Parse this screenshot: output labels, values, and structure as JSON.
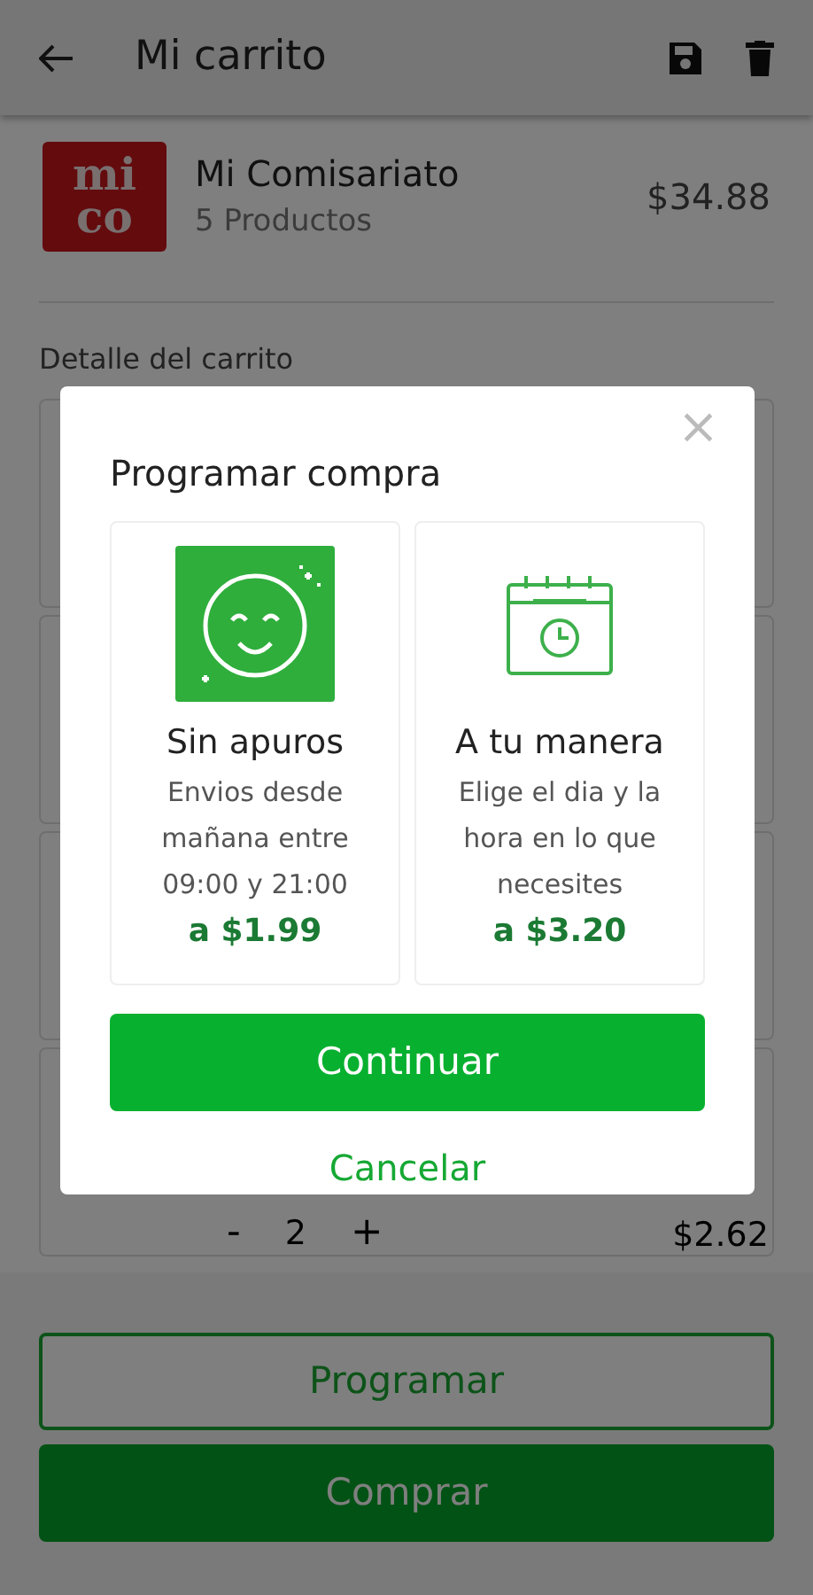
{
  "header": {
    "title": "Mi carrito"
  },
  "store": {
    "logo_top": "mi",
    "logo_bottom": "co",
    "name": "Mi Comisariato",
    "count": "5 Productos",
    "total": "$34.88"
  },
  "detail_heading": "Detalle del carrito",
  "items": [
    {
      "price": "$2.62",
      "minus": "-",
      "quantity": "2",
      "plus": "+"
    }
  ],
  "buttons": [
    {
      "label": "Programar",
      "kind": "outline"
    },
    {
      "label": "Comprar",
      "kind": "filled"
    }
  ],
  "dialog": {
    "title": "Programar compra",
    "close": "×",
    "options": [
      {
        "title": "Sin apuros",
        "kind": "smile",
        "description": "Envios desde mañana entre 09:00 y 21:00",
        "price": "a $1.99"
      },
      {
        "title": "A tu manera",
        "kind": "calendar",
        "description": "Elige el dia y la hora en lo que necesites",
        "price": "a $3.20"
      }
    ],
    "confirm": "Continuar",
    "cancel": "Cancelar"
  }
}
